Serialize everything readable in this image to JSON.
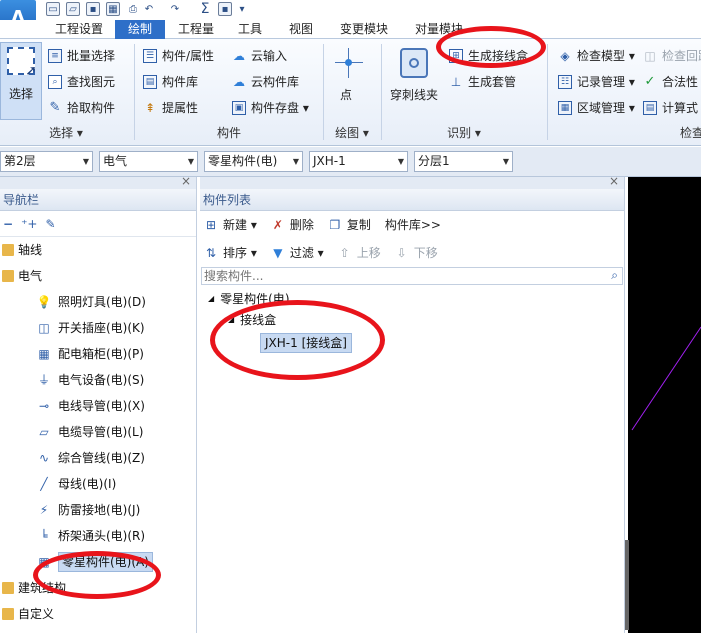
{
  "app": {
    "logo": "A"
  },
  "tabs": [
    "工程设置",
    "绘制",
    "工程量",
    "工具",
    "视图",
    "变更模块",
    "对量模块"
  ],
  "ribbon": {
    "select_group": {
      "select_label": "选择",
      "items": [
        "批量选择",
        "查找图元",
        "拾取构件"
      ],
      "group_label": "选择 ▾"
    },
    "component_group": {
      "items": [
        "构件/属性",
        "构件库",
        "提属性",
        "云输入",
        "云构件库",
        "构件存盘 ▾"
      ],
      "group_label": "构件"
    },
    "draw_group": {
      "point_label": "点",
      "group_label": "绘图 ▾"
    },
    "identify_group": {
      "wall_clip_label": "穿刺线夹",
      "items": [
        "生成接线盒",
        "生成套管"
      ],
      "group_label": "识别 ▾"
    },
    "check_group": {
      "items": [
        "检查模型 ▾",
        "记录管理 ▾",
        "区域管理 ▾"
      ],
      "disabled_item": "检查回路",
      "items2": [
        "合法性",
        "计算式"
      ],
      "group_label": "检查"
    }
  },
  "toolbar": {
    "floor": "第2层",
    "discipline": "电气",
    "category": "零星构件(电)",
    "component": "JXH-1",
    "layer": "分层1"
  },
  "nav": {
    "title": "导航栏",
    "close": "×",
    "tree": [
      {
        "label": "轴线",
        "level": 0,
        "expander": "▸"
      },
      {
        "label": "电气",
        "level": 0,
        "expander": "▾"
      },
      {
        "label": "照明灯具(电)(D)",
        "level": 1,
        "icon": "lamp-icon"
      },
      {
        "label": "开关插座(电)(K)",
        "level": 1,
        "icon": "switch-icon"
      },
      {
        "label": "配电箱柜(电)(P)",
        "level": 1,
        "icon": "cabinet-icon"
      },
      {
        "label": "电气设备(电)(S)",
        "level": 1,
        "icon": "equipment-icon"
      },
      {
        "label": "电线导管(电)(X)",
        "level": 1,
        "icon": "conduit-icon"
      },
      {
        "label": "电缆导管(电)(L)",
        "level": 1,
        "icon": "cable-icon"
      },
      {
        "label": "综合管线(电)(Z)",
        "level": 1,
        "icon": "pipeline-icon"
      },
      {
        "label": "母线(电)(I)",
        "level": 1,
        "icon": "busbar-icon"
      },
      {
        "label": "防雷接地(电)(J)",
        "level": 1,
        "icon": "lightning-icon"
      },
      {
        "label": "桥架通头(电)(R)",
        "level": 1,
        "icon": "bridge-icon"
      },
      {
        "label": "零星构件(电)(A)",
        "level": 1,
        "icon": "grid-icon",
        "selected": true
      },
      {
        "label": "建筑结构",
        "level": 0,
        "expander": "▸"
      },
      {
        "label": "自定义",
        "level": 0,
        "expander": "▸"
      }
    ]
  },
  "list": {
    "title": "构件列表",
    "close": "×",
    "toolbar1": [
      "新建 ▾",
      "删除",
      "复制",
      "构件库>>"
    ],
    "toolbar2": [
      "排序 ▾",
      "过滤 ▾",
      "上移",
      "下移"
    ],
    "search_placeholder": "搜索构件...",
    "tree": {
      "root": "零星构件(电)",
      "child": "接线盒",
      "leaf": "JXH-1 [接线盒]"
    }
  },
  "colors": {
    "accent": "#2e6fc8",
    "annotation": "#e8141b",
    "canvas": "#000000",
    "line": "#a020f0"
  }
}
